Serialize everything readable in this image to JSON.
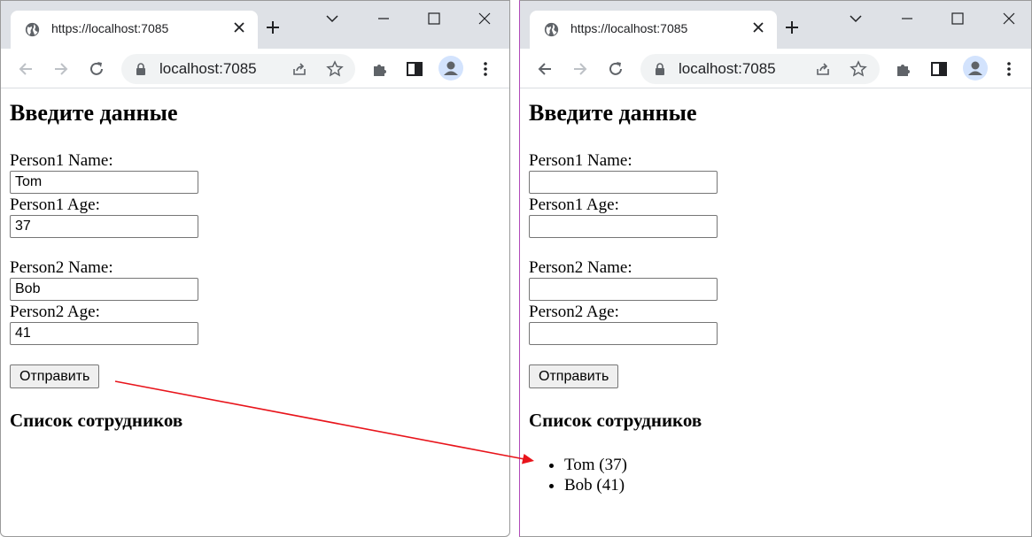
{
  "windows": [
    {
      "tab_title": "https://localhost:7085",
      "address": "localhost:7085",
      "page": {
        "heading": "Введите данные",
        "person1_name_label": "Person1 Name:",
        "person1_name_value": "Tom",
        "person1_age_label": "Person1 Age:",
        "person1_age_value": "37",
        "person2_name_label": "Person2 Name:",
        "person2_name_value": "Bob",
        "person2_age_label": "Person2 Age:",
        "person2_age_value": "41",
        "submit_label": "Отправить",
        "list_heading": "Список сотрудников",
        "employees": []
      }
    },
    {
      "tab_title": "https://localhost:7085",
      "address": "localhost:7085",
      "page": {
        "heading": "Введите данные",
        "person1_name_label": "Person1 Name:",
        "person1_name_value": "",
        "person1_age_label": "Person1 Age:",
        "person1_age_value": "",
        "person2_name_label": "Person2 Name:",
        "person2_name_value": "",
        "person2_age_label": "Person2 Age:",
        "person2_age_value": "",
        "submit_label": "Отправить",
        "list_heading": "Список сотрудников",
        "employees": [
          "Tom (37)",
          "Bob (41)"
        ]
      }
    }
  ],
  "annotation": {
    "arrow_color": "#e8141b"
  }
}
